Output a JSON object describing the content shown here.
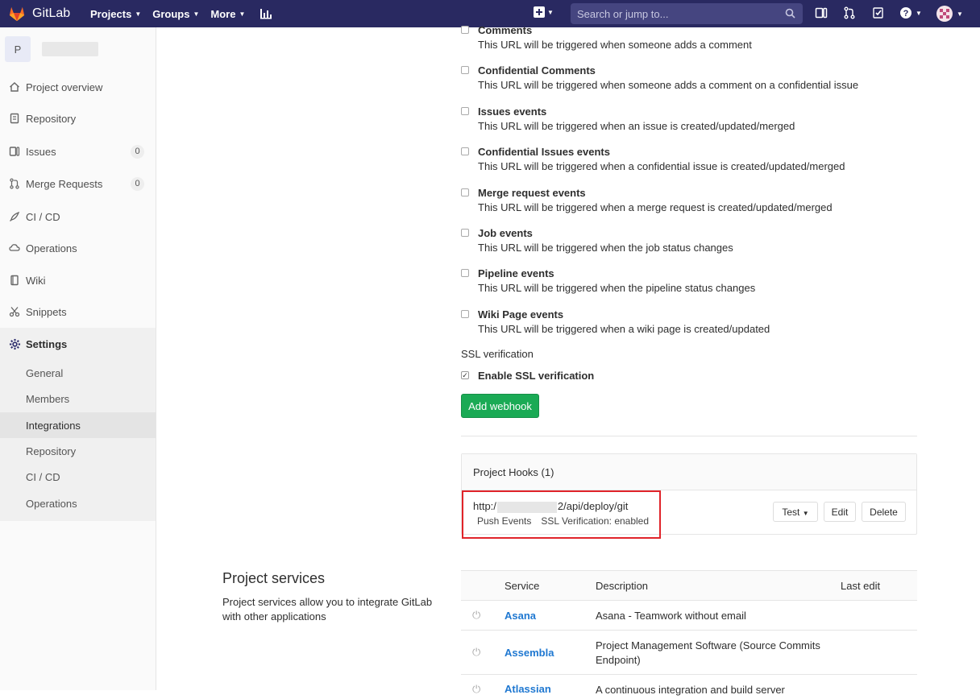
{
  "navbar": {
    "brand": "GitLab",
    "links": [
      "Projects",
      "Groups",
      "More"
    ],
    "search_placeholder": "Search or jump to...",
    "icons": [
      "chart-icon",
      "plus-icon",
      "search-icon",
      "sidebar-toggle-icon",
      "merge-request-icon",
      "todo-icon",
      "help-icon",
      "user-avatar-icon"
    ]
  },
  "sidebar": {
    "project_avatar": "P",
    "items": [
      {
        "label": "Project overview",
        "icon": "home-icon"
      },
      {
        "label": "Repository",
        "icon": "doc-icon"
      },
      {
        "label": "Issues",
        "icon": "issues-icon",
        "badge": "0"
      },
      {
        "label": "Merge Requests",
        "icon": "merge-request-icon",
        "badge": "0"
      },
      {
        "label": "CI / CD",
        "icon": "rocket-icon"
      },
      {
        "label": "Operations",
        "icon": "cloud-icon"
      },
      {
        "label": "Wiki",
        "icon": "book-icon"
      },
      {
        "label": "Snippets",
        "icon": "scissors-icon"
      },
      {
        "label": "Settings",
        "icon": "gear-icon"
      }
    ],
    "settings_sub": [
      "General",
      "Members",
      "Integrations",
      "Repository",
      "CI / CD",
      "Operations"
    ]
  },
  "events": [
    {
      "title": "Comments",
      "desc": "This URL will be triggered when someone adds a comment"
    },
    {
      "title": "Confidential Comments",
      "desc": "This URL will be triggered when someone adds a comment on a confidential issue"
    },
    {
      "title": "Issues events",
      "desc": "This URL will be triggered when an issue is created/updated/merged"
    },
    {
      "title": "Confidential Issues events",
      "desc": "This URL will be triggered when a confidential issue is created/updated/merged"
    },
    {
      "title": "Merge request events",
      "desc": "This URL will be triggered when a merge request is created/updated/merged"
    },
    {
      "title": "Job events",
      "desc": "This URL will be triggered when the job status changes"
    },
    {
      "title": "Pipeline events",
      "desc": "This URL will be triggered when the pipeline status changes"
    },
    {
      "title": "Wiki Page events",
      "desc": "This URL will be triggered when a wiki page is created/updated"
    }
  ],
  "ssl": {
    "label": "SSL verification",
    "checkbox_label": "Enable SSL verification",
    "checked": true
  },
  "add_webhook_label": "Add webhook",
  "hooks": {
    "header": "Project Hooks (1)",
    "url_prefix": "http:/",
    "url_suffix": "2/api/deploy/git",
    "tags": [
      "Push Events",
      "SSL Verification: enabled"
    ],
    "buttons": {
      "test": "Test",
      "edit": "Edit",
      "delete": "Delete"
    },
    "highlight_color": "#e0242a"
  },
  "project_services": {
    "title": "Project services",
    "desc": "Project services allow you to integrate GitLab with other applications",
    "columns": [
      "Service",
      "Description",
      "Last edit"
    ],
    "rows": [
      {
        "name": "Asana",
        "desc": "Asana - Teamwork without email"
      },
      {
        "name": "Assembla",
        "desc": "Project Management Software (Source Commits Endpoint)"
      },
      {
        "name": "Atlassian",
        "desc": "A continuous integration and build server"
      }
    ]
  },
  "colors": {
    "navbar": "#292961",
    "button_green": "#1aaa55",
    "link_blue": "#1f78d1"
  }
}
